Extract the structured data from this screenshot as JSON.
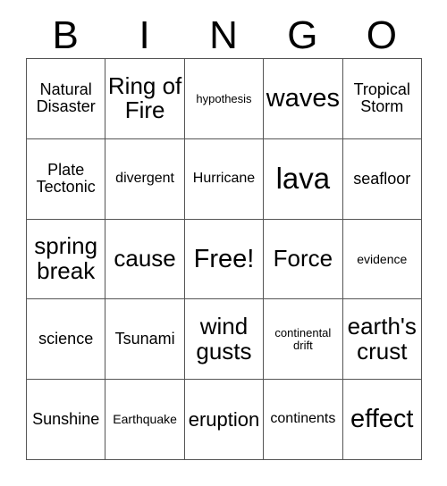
{
  "card": {
    "title": "BINGO",
    "header_letters": [
      "B",
      "I",
      "N",
      "G",
      "O"
    ],
    "free_space": "Free!",
    "colors": {
      "background": "#ffffff",
      "text": "#000000",
      "grid_line": "#555555",
      "grid_border": "#444444"
    },
    "grid": {
      "columns": 5,
      "rows": 5,
      "cells": [
        [
          {
            "text": "Natural Disaster",
            "size": "t-lg"
          },
          {
            "text": "Ring of Fire",
            "size": "t-2xl"
          },
          {
            "text": "hypothesis",
            "size": "t-xs"
          },
          {
            "text": "waves",
            "size": "t-3xl"
          },
          {
            "text": "Tropical Storm",
            "size": "t-lg"
          }
        ],
        [
          {
            "text": "Plate Tectonic",
            "size": "t-lg"
          },
          {
            "text": "divergent",
            "size": "t-md"
          },
          {
            "text": "Hurricane",
            "size": "t-md"
          },
          {
            "text": "lava",
            "size": "t-4xl"
          },
          {
            "text": "seafloor",
            "size": "t-lg"
          }
        ],
        [
          {
            "text": "spring break",
            "size": "t-2xl"
          },
          {
            "text": "cause",
            "size": "t-2xl"
          },
          {
            "text": "Free!",
            "size": "t-3xl"
          },
          {
            "text": "Force",
            "size": "t-2xl"
          },
          {
            "text": "evidence",
            "size": "t-sm"
          }
        ],
        [
          {
            "text": "science",
            "size": "t-lg"
          },
          {
            "text": "Tsunami",
            "size": "t-lg"
          },
          {
            "text": "wind gusts",
            "size": "t-2xl"
          },
          {
            "text": "continental drift",
            "size": "t-xs"
          },
          {
            "text": "earth's crust",
            "size": "t-2xl"
          }
        ],
        [
          {
            "text": "Sunshine",
            "size": "t-lg"
          },
          {
            "text": "Earthquake",
            "size": "t-sm"
          },
          {
            "text": "eruption",
            "size": "t-xl"
          },
          {
            "text": "continents",
            "size": "t-md"
          },
          {
            "text": "effect",
            "size": "t-3xl"
          }
        ]
      ]
    }
  }
}
